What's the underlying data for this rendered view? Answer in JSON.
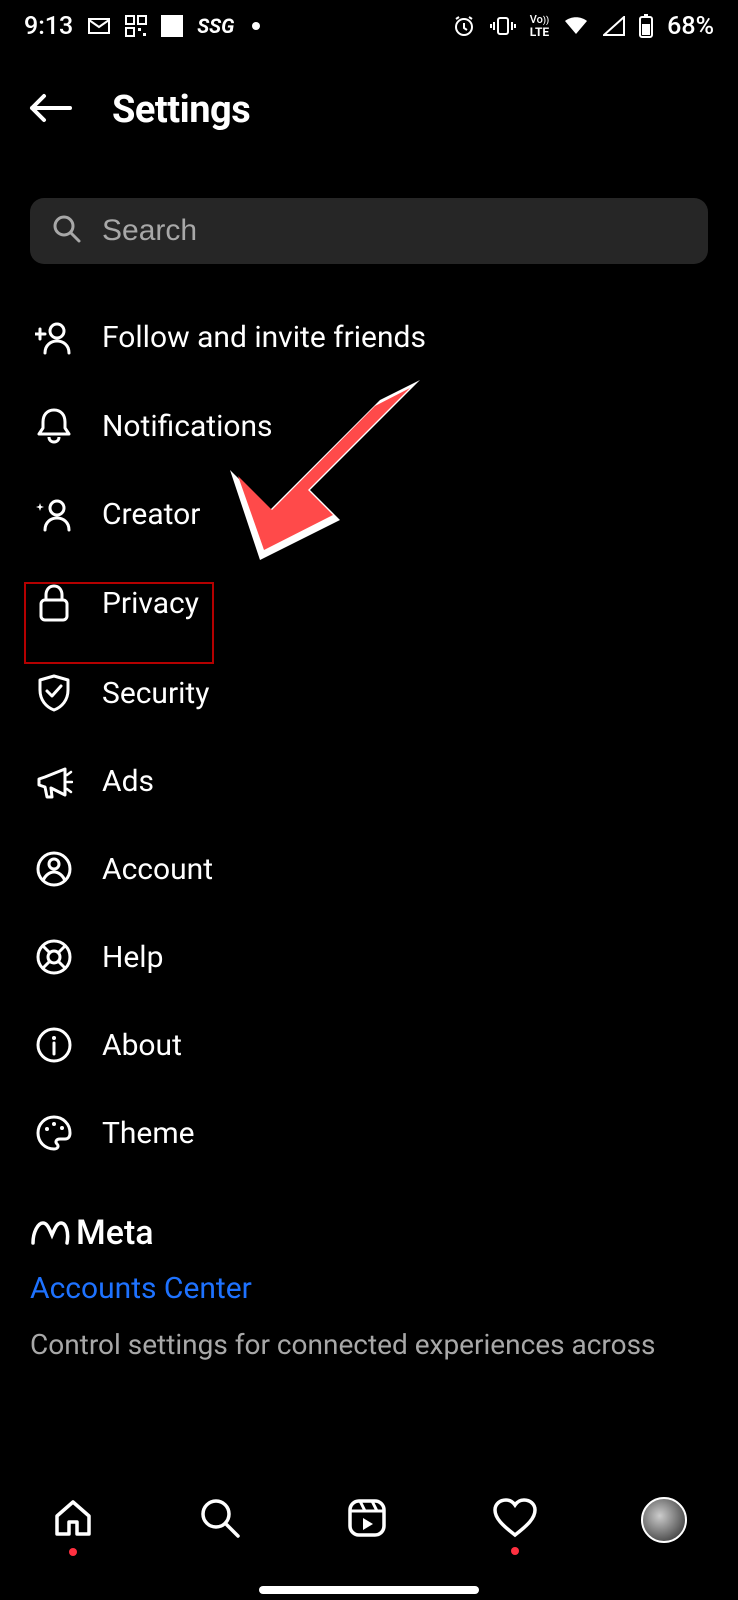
{
  "statusbar": {
    "time": "9:13",
    "ssg": "SSG",
    "battery": "68%"
  },
  "header": {
    "title": "Settings"
  },
  "search": {
    "placeholder": "Search"
  },
  "menu": [
    {
      "icon": "person-plus-icon",
      "label": "Follow and invite friends"
    },
    {
      "icon": "bell-icon",
      "label": "Notifications"
    },
    {
      "icon": "creator-icon",
      "label": "Creator"
    },
    {
      "icon": "lock-icon",
      "label": "Privacy"
    },
    {
      "icon": "shield-check-icon",
      "label": "Security"
    },
    {
      "icon": "megaphone-icon",
      "label": "Ads"
    },
    {
      "icon": "account-icon",
      "label": "Account"
    },
    {
      "icon": "lifebuoy-icon",
      "label": "Help"
    },
    {
      "icon": "info-icon",
      "label": "About"
    },
    {
      "icon": "palette-icon",
      "label": "Theme"
    }
  ],
  "meta": {
    "brand": "Meta",
    "link": "Accounts Center",
    "desc": "Control settings for connected experiences across"
  },
  "annotation": {
    "highlight_target": "Privacy",
    "arrow_color": "#ff4a4a"
  }
}
